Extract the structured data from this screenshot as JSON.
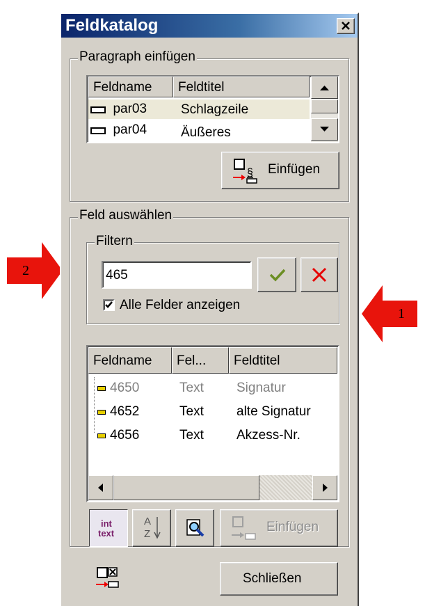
{
  "window": {
    "title": "Feldkatalog",
    "close_glyph": "✕"
  },
  "paragraph_group": {
    "legend": "Paragraph einfügen",
    "columns": [
      "Feldname",
      "Feldtitel"
    ],
    "rows": [
      {
        "name": "par03",
        "title": "Schlagzeile"
      },
      {
        "name": "par04",
        "title": "Äußeres"
      }
    ],
    "insert_label": "Einfügen"
  },
  "field_group": {
    "legend": "Feld auswählen",
    "filter": {
      "legend": "Filtern",
      "value": "465",
      "show_all_label": "Alle Felder anzeigen",
      "show_all_checked": true
    },
    "columns": [
      "Feldname",
      "Fel...",
      "Feldtitel"
    ],
    "rows": [
      {
        "name": "4650",
        "type": "Text",
        "title": "Signatur",
        "disabled": true
      },
      {
        "name": "4652",
        "type": "Text",
        "title": "alte Signatur",
        "disabled": false
      },
      {
        "name": "4656",
        "type": "Text",
        "title": "Akzess-Nr.",
        "disabled": false
      }
    ],
    "int_text_label_1": "int",
    "int_text_label_2": "text",
    "sort_label_a": "A",
    "sort_label_z": "Z",
    "insert_label": "Einfügen"
  },
  "close_label": "Schließen",
  "annotations": {
    "left": "2",
    "right": "1"
  },
  "colors": {
    "arrow": "#e8140c",
    "title_start": "#0a246a",
    "checkmark": "#6b8e23",
    "cross": "#e60000",
    "int_text": "#7a1f6a"
  }
}
